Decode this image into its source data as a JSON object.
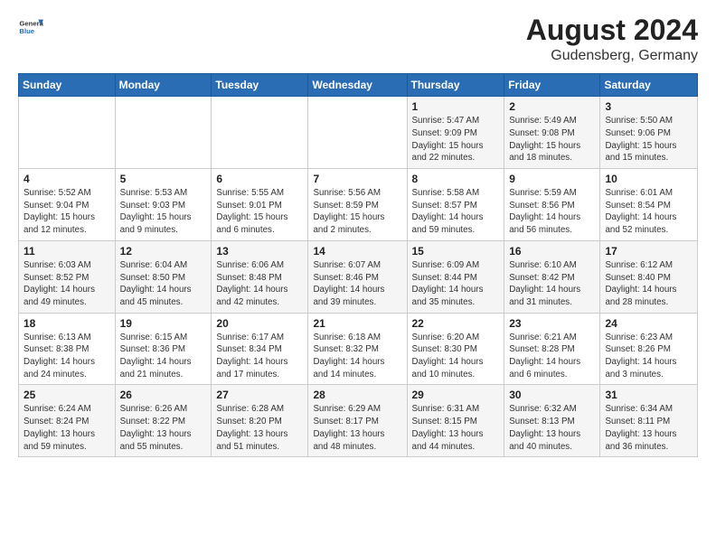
{
  "logo": {
    "general": "General",
    "blue": "Blue"
  },
  "title": "August 2024",
  "subtitle": "Gudensberg, Germany",
  "days_of_week": [
    "Sunday",
    "Monday",
    "Tuesday",
    "Wednesday",
    "Thursday",
    "Friday",
    "Saturday"
  ],
  "weeks": [
    [
      {
        "day": "",
        "info": ""
      },
      {
        "day": "",
        "info": ""
      },
      {
        "day": "",
        "info": ""
      },
      {
        "day": "",
        "info": ""
      },
      {
        "day": "1",
        "info": "Sunrise: 5:47 AM\nSunset: 9:09 PM\nDaylight: 15 hours\nand 22 minutes."
      },
      {
        "day": "2",
        "info": "Sunrise: 5:49 AM\nSunset: 9:08 PM\nDaylight: 15 hours\nand 18 minutes."
      },
      {
        "day": "3",
        "info": "Sunrise: 5:50 AM\nSunset: 9:06 PM\nDaylight: 15 hours\nand 15 minutes."
      }
    ],
    [
      {
        "day": "4",
        "info": "Sunrise: 5:52 AM\nSunset: 9:04 PM\nDaylight: 15 hours\nand 12 minutes."
      },
      {
        "day": "5",
        "info": "Sunrise: 5:53 AM\nSunset: 9:03 PM\nDaylight: 15 hours\nand 9 minutes."
      },
      {
        "day": "6",
        "info": "Sunrise: 5:55 AM\nSunset: 9:01 PM\nDaylight: 15 hours\nand 6 minutes."
      },
      {
        "day": "7",
        "info": "Sunrise: 5:56 AM\nSunset: 8:59 PM\nDaylight: 15 hours\nand 2 minutes."
      },
      {
        "day": "8",
        "info": "Sunrise: 5:58 AM\nSunset: 8:57 PM\nDaylight: 14 hours\nand 59 minutes."
      },
      {
        "day": "9",
        "info": "Sunrise: 5:59 AM\nSunset: 8:56 PM\nDaylight: 14 hours\nand 56 minutes."
      },
      {
        "day": "10",
        "info": "Sunrise: 6:01 AM\nSunset: 8:54 PM\nDaylight: 14 hours\nand 52 minutes."
      }
    ],
    [
      {
        "day": "11",
        "info": "Sunrise: 6:03 AM\nSunset: 8:52 PM\nDaylight: 14 hours\nand 49 minutes."
      },
      {
        "day": "12",
        "info": "Sunrise: 6:04 AM\nSunset: 8:50 PM\nDaylight: 14 hours\nand 45 minutes."
      },
      {
        "day": "13",
        "info": "Sunrise: 6:06 AM\nSunset: 8:48 PM\nDaylight: 14 hours\nand 42 minutes."
      },
      {
        "day": "14",
        "info": "Sunrise: 6:07 AM\nSunset: 8:46 PM\nDaylight: 14 hours\nand 39 minutes."
      },
      {
        "day": "15",
        "info": "Sunrise: 6:09 AM\nSunset: 8:44 PM\nDaylight: 14 hours\nand 35 minutes."
      },
      {
        "day": "16",
        "info": "Sunrise: 6:10 AM\nSunset: 8:42 PM\nDaylight: 14 hours\nand 31 minutes."
      },
      {
        "day": "17",
        "info": "Sunrise: 6:12 AM\nSunset: 8:40 PM\nDaylight: 14 hours\nand 28 minutes."
      }
    ],
    [
      {
        "day": "18",
        "info": "Sunrise: 6:13 AM\nSunset: 8:38 PM\nDaylight: 14 hours\nand 24 minutes."
      },
      {
        "day": "19",
        "info": "Sunrise: 6:15 AM\nSunset: 8:36 PM\nDaylight: 14 hours\nand 21 minutes."
      },
      {
        "day": "20",
        "info": "Sunrise: 6:17 AM\nSunset: 8:34 PM\nDaylight: 14 hours\nand 17 minutes."
      },
      {
        "day": "21",
        "info": "Sunrise: 6:18 AM\nSunset: 8:32 PM\nDaylight: 14 hours\nand 14 minutes."
      },
      {
        "day": "22",
        "info": "Sunrise: 6:20 AM\nSunset: 8:30 PM\nDaylight: 14 hours\nand 10 minutes."
      },
      {
        "day": "23",
        "info": "Sunrise: 6:21 AM\nSunset: 8:28 PM\nDaylight: 14 hours\nand 6 minutes."
      },
      {
        "day": "24",
        "info": "Sunrise: 6:23 AM\nSunset: 8:26 PM\nDaylight: 14 hours\nand 3 minutes."
      }
    ],
    [
      {
        "day": "25",
        "info": "Sunrise: 6:24 AM\nSunset: 8:24 PM\nDaylight: 13 hours\nand 59 minutes."
      },
      {
        "day": "26",
        "info": "Sunrise: 6:26 AM\nSunset: 8:22 PM\nDaylight: 13 hours\nand 55 minutes."
      },
      {
        "day": "27",
        "info": "Sunrise: 6:28 AM\nSunset: 8:20 PM\nDaylight: 13 hours\nand 51 minutes."
      },
      {
        "day": "28",
        "info": "Sunrise: 6:29 AM\nSunset: 8:17 PM\nDaylight: 13 hours\nand 48 minutes."
      },
      {
        "day": "29",
        "info": "Sunrise: 6:31 AM\nSunset: 8:15 PM\nDaylight: 13 hours\nand 44 minutes."
      },
      {
        "day": "30",
        "info": "Sunrise: 6:32 AM\nSunset: 8:13 PM\nDaylight: 13 hours\nand 40 minutes."
      },
      {
        "day": "31",
        "info": "Sunrise: 6:34 AM\nSunset: 8:11 PM\nDaylight: 13 hours\nand 36 minutes."
      }
    ]
  ]
}
